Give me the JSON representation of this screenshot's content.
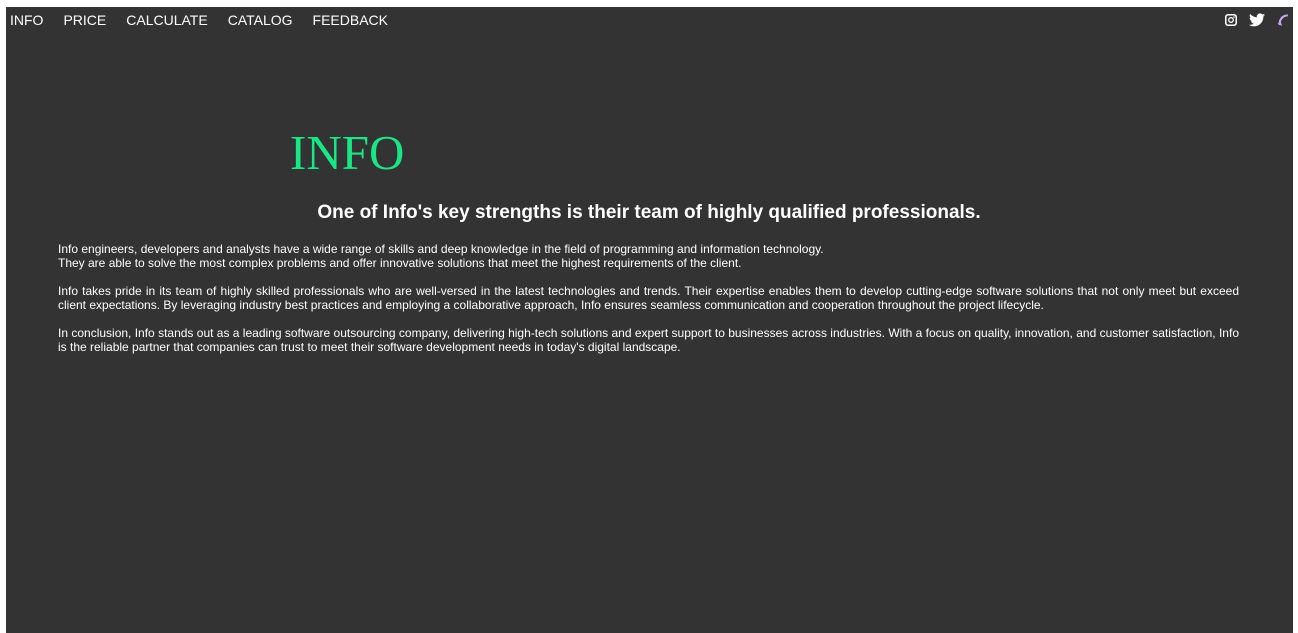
{
  "nav": {
    "items": [
      "INFO",
      "PRICE",
      "CALCULATE",
      "CATALOG",
      "FEEDBACK"
    ]
  },
  "social": {
    "icons": [
      "instagram-icon",
      "twitter-icon",
      "viber-icon"
    ]
  },
  "main": {
    "title": "INFO",
    "subtitle": "One of Info's key strengths is their team of highly qualified professionals.",
    "paragraph1_line1": "Info engineers, developers and analysts have a wide range of skills and deep knowledge in the field of programming and information technology.",
    "paragraph1_line2": "They are able to solve the most complex problems and offer innovative solutions that meet the highest requirements of the client.",
    "paragraph2": "Info takes pride in its team of highly skilled professionals who are well-versed in the latest technologies and trends. Their expertise enables them to develop cutting-edge software solutions that not only meet but exceed client expectations. By leveraging industry best practices and employing a collaborative approach, Info ensures seamless communication and cooperation throughout the project lifecycle.",
    "paragraph3": "In conclusion, Info stands out as a leading software outsourcing company, delivering high-tech solutions and expert support to businesses across industries. With a focus on quality, innovation, and customer satisfaction, Info is the reliable partner that companies can trust to meet their software development needs in today's digital landscape."
  },
  "colors": {
    "background": "#333333",
    "title_accent": "#17e886",
    "text": "#ffffff",
    "viber_accent": "#c9a6f5"
  }
}
